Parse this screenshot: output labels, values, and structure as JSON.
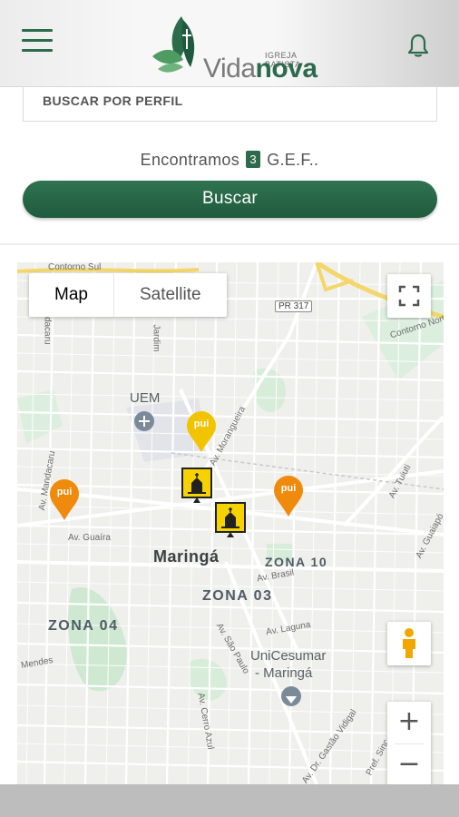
{
  "header": {
    "logo_top": "IGREJA BATISTA",
    "logo_word_a": "Vida",
    "logo_word_b": "nova"
  },
  "search": {
    "profile_placeholder": "BUSCAR POR PERFIL",
    "result_prefix": "Encontramos",
    "result_count": "3",
    "result_suffix": "G.E.F..",
    "button_label": "Buscar"
  },
  "map": {
    "type_map": "Map",
    "type_satellite": "Satellite",
    "zoom_in": "+",
    "zoom_out": "−",
    "labels": {
      "contorno_sul": "Contorno Sul",
      "contorno_norte": "Contorno Nort",
      "pr317": "PR 317",
      "uem": "UEM",
      "city": "Maringá",
      "zona10": "ZONA 10",
      "zona03": "ZONA 03",
      "zona04": "ZONA 04",
      "unicesumar_1": "UniCesumar",
      "unicesumar_2": "- Maringá",
      "av_guaira": "Av. Guaíra",
      "av_brasil": "Av. Brasil",
      "av_laguna": "Av. Laguna",
      "av_sao_paulo": "Av. São Paulo",
      "av_cerro_azul": "Av. Cerro Azul",
      "av_gestao": "Av. Dr. Gastão Vidigal",
      "av_mandacaru": "Av. Mandacaru",
      "av_tuiuti": "Av. Tuiuti",
      "av_guaiapo": "Av. Guaiapó",
      "av_morangueira": "Av. Morangueira",
      "av_mendes": "Mendes",
      "r_jardim": "Jardim",
      "r_tabajara": "Mandacaru",
      "pref_sinc": "Pref. Sinc"
    },
    "marker_text": "pui"
  },
  "colors": {
    "brand_green": "#2d6b4d",
    "marker_orange": "#ef8a0c",
    "marker_yellow": "#f2c400",
    "church_yellow": "#f5d200"
  }
}
